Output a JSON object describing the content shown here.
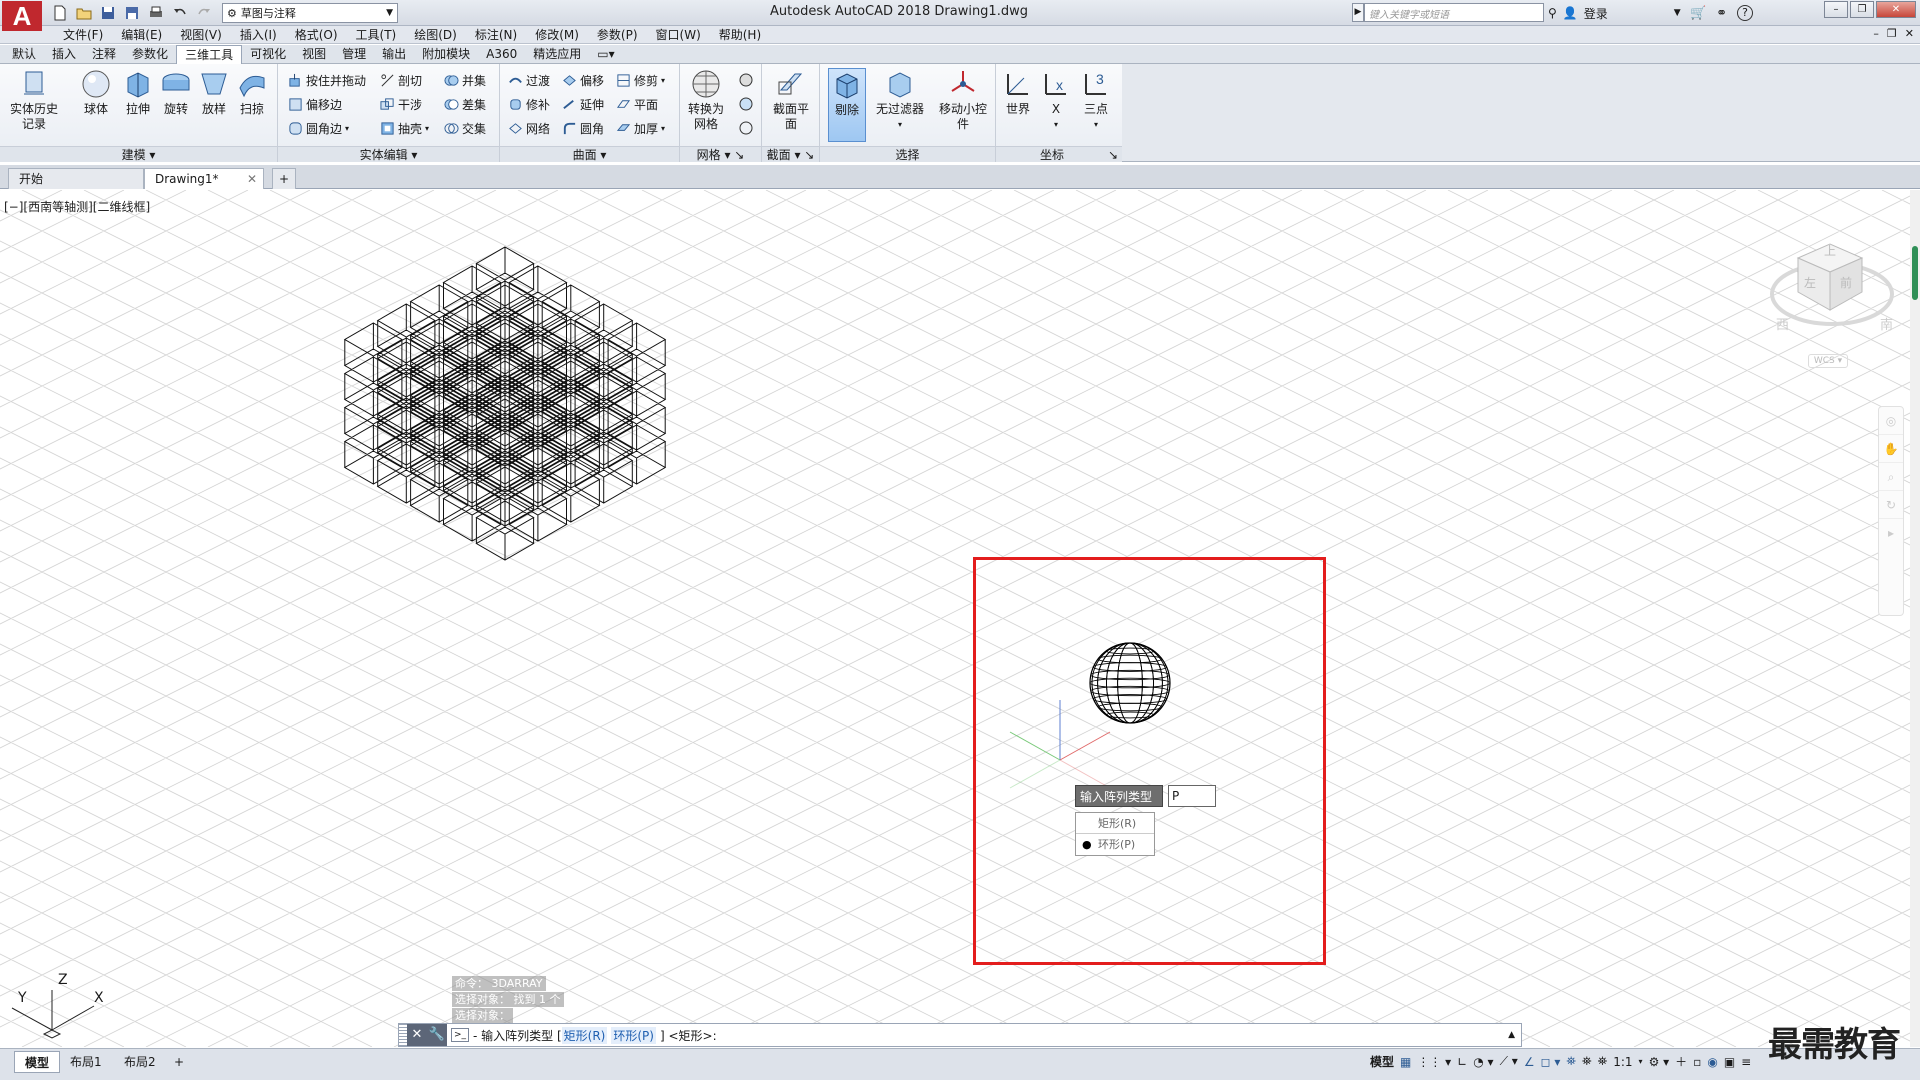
{
  "app": {
    "title": "Autodesk AutoCAD 2018    Drawing1.dwg",
    "logo_letter": "A",
    "workspace": "草图与注释",
    "search_placeholder": "键入关键字或短语",
    "login_label": "登录",
    "help_label": "?"
  },
  "menubar": {
    "items": [
      "文件(F)",
      "编辑(E)",
      "视图(V)",
      "插入(I)",
      "格式(O)",
      "工具(T)",
      "绘图(D)",
      "标注(N)",
      "修改(M)",
      "参数(P)",
      "窗口(W)",
      "帮助(H)"
    ]
  },
  "ribbon_tabs": {
    "items": [
      "默认",
      "插入",
      "注释",
      "参数化",
      "三维工具",
      "可视化",
      "视图",
      "管理",
      "输出",
      "附加模块",
      "A360",
      "精选应用"
    ],
    "active": "三维工具"
  },
  "ribbon": {
    "modeling": {
      "title": "建模",
      "history": "实体历史记录",
      "sphere": "球体",
      "extrude": "拉伸",
      "revolve": "旋转",
      "loft": "放样",
      "sweep": "扫掠"
    },
    "solid_edit": {
      "title": "实体编辑",
      "presspull": "按住并拖动",
      "offset_edge": "偏移边",
      "fillet_edge": "圆角边",
      "slice": "剖切",
      "interfere": "干涉",
      "shell": "抽壳",
      "union": "并集",
      "subtract": "差集",
      "intersect": "交集"
    },
    "surface": {
      "title": "曲面",
      "blend": "过渡",
      "patch": "修补",
      "network": "网络",
      "offset": "偏移",
      "extend": "延伸",
      "fillet": "圆角",
      "trim": "修剪",
      "planar": "平面",
      "thicken": "加厚"
    },
    "mesh": {
      "title": "网格",
      "convert": "转换为网格"
    },
    "section": {
      "title": "截面",
      "plane": "截面平面"
    },
    "selection": {
      "title": "选择",
      "cull": "剔除",
      "filter": "无过滤器",
      "gizmo": "移动小控件"
    },
    "coordinates": {
      "title": "坐标",
      "world": "世界",
      "x": "X",
      "three_point": "三点"
    }
  },
  "doc_tabs": {
    "start": "开始",
    "drawing": "Drawing1*"
  },
  "viewport": {
    "label": "[−][西南等轴测][二维线框]",
    "cube_top": "上",
    "cube_left": "左",
    "cube_front": "前",
    "dir_west": "西",
    "dir_south": "南",
    "wcs": "WCS"
  },
  "ucs": {
    "x": "X",
    "y": "Y",
    "z": "Z"
  },
  "dynamic_input": {
    "prompt": "输入阵列类型",
    "value": "P",
    "options": [
      "矩形(R)",
      "环形(P)"
    ],
    "selected": "环形(P)"
  },
  "command": {
    "history": [
      "命令： 3DARRAY",
      "选择对象： 找到 1 个",
      "选择对象："
    ],
    "prompt_prefix": "- 输入阵列类型 [",
    "opt_r": "矩形(R)",
    "opt_p": "环形(P)",
    "prompt_suffix": "] <矩形>:"
  },
  "layouts": {
    "model": "模型",
    "layout1": "布局1",
    "layout2": "布局2"
  },
  "statusbar": {
    "model": "模型",
    "scale": "1:1"
  },
  "watermark": "最需教育",
  "colors": {
    "highlight": "#e31d1d",
    "accent": "#c0282e"
  }
}
